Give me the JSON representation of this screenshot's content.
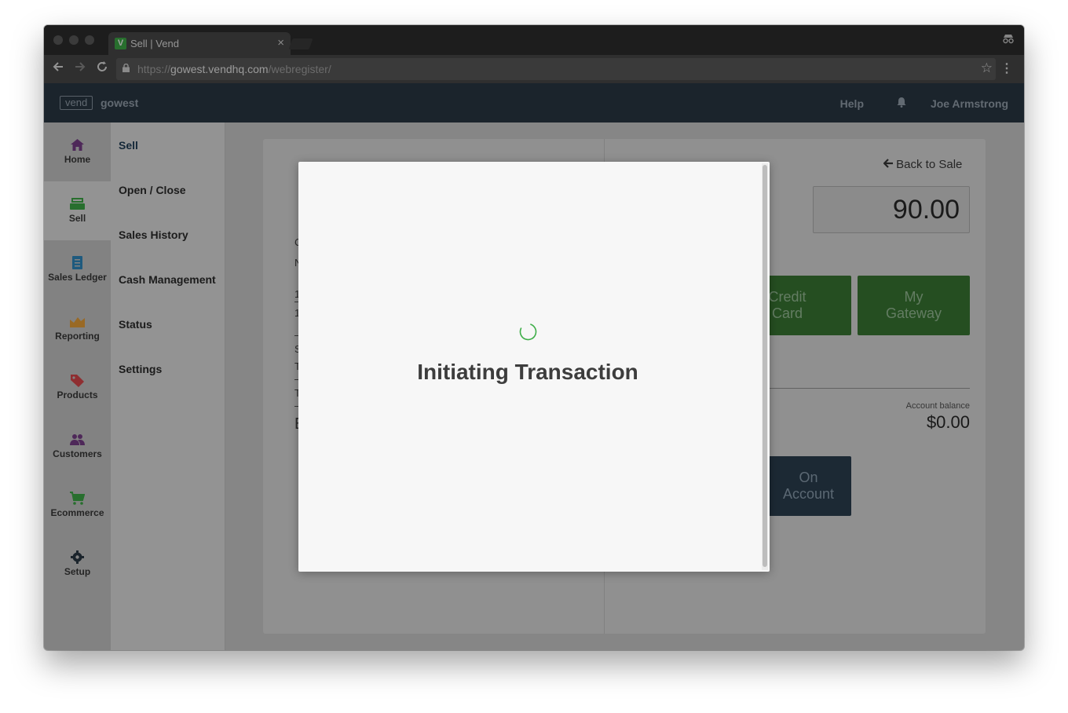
{
  "browser": {
    "tab_title": "Sell | Vend",
    "tab_favicon": "V",
    "url_scheme": "https://",
    "url_host": "gowest.vendhq.com",
    "url_path": "/webregister/"
  },
  "app": {
    "logo": "vend",
    "store": "gowest",
    "help": "Help",
    "user": "Joe Armstrong"
  },
  "sidebar": {
    "items": [
      {
        "label": "Home",
        "icon": "home-icon",
        "color": "#7b3f8c"
      },
      {
        "label": "Sell",
        "icon": "register-icon",
        "color": "#3fae49"
      },
      {
        "label": "Sales Ledger",
        "icon": "ledger-icon",
        "color": "#2f8dc6"
      },
      {
        "label": "Reporting",
        "icon": "chart-icon",
        "color": "#f0a53a"
      },
      {
        "label": "Products",
        "icon": "tag-icon",
        "color": "#e0484e"
      },
      {
        "label": "Customers",
        "icon": "customers-icon",
        "color": "#7b3f8c"
      },
      {
        "label": "Ecommerce",
        "icon": "cart-icon",
        "color": "#3fae49"
      },
      {
        "label": "Setup",
        "icon": "gear-icon",
        "color": "#2b3946"
      }
    ]
  },
  "submenu": {
    "items": [
      "Sell",
      "Open / Close",
      "Sales History",
      "Cash Management",
      "Status",
      "Settings"
    ]
  },
  "payment": {
    "back_label": "Back to Sale",
    "amount": "90.00",
    "credit_card": [
      "Credit",
      "Card"
    ],
    "my_gateway": [
      "My",
      "Gateway"
    ],
    "account_balance_label": "Account balance",
    "account_balance_value": "$0.00",
    "on_account": [
      "On",
      "Account"
    ]
  },
  "modal": {
    "title": "Initiating Transaction"
  },
  "colors": {
    "accent_green": "#3fae49",
    "topbar": "#2b3946"
  }
}
